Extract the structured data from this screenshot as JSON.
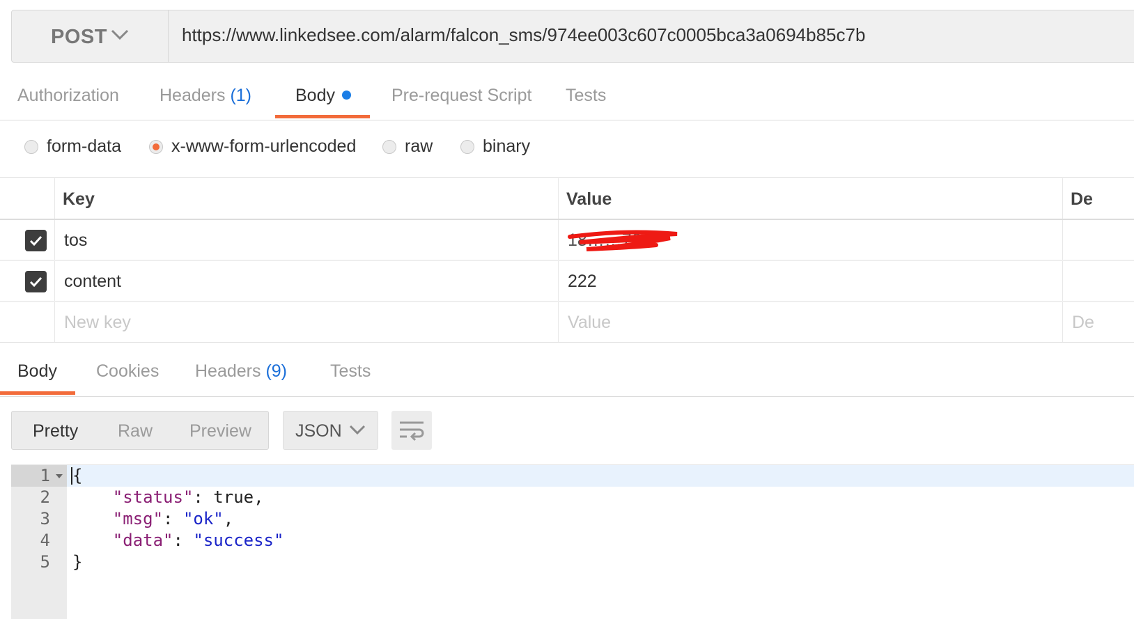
{
  "request": {
    "method": "POST",
    "url": "https://www.linkedsee.com/alarm/falcon_sms/974ee003c607c0005bca3a0694b85c7b"
  },
  "request_tabs": [
    {
      "label": "Authorization"
    },
    {
      "label": "Headers",
      "count": "(1)"
    },
    {
      "label": "Body",
      "active": true
    },
    {
      "label": "Pre-request Script"
    },
    {
      "label": "Tests"
    }
  ],
  "body_modes": [
    {
      "label": "form-data",
      "selected": false
    },
    {
      "label": "x-www-form-urlencoded",
      "selected": true
    },
    {
      "label": "raw",
      "selected": false
    },
    {
      "label": "binary",
      "selected": false
    }
  ],
  "kv_table": {
    "headers": {
      "key": "Key",
      "value": "Value",
      "description": "De"
    },
    "rows": [
      {
        "checked": true,
        "key": "tos",
        "value": "18……76",
        "value_redacted": true
      },
      {
        "checked": true,
        "key": "content",
        "value": "222"
      }
    ],
    "placeholder": {
      "key": "New key",
      "value": "Value",
      "description": "De"
    }
  },
  "response_tabs": [
    {
      "label": "Body",
      "active": true
    },
    {
      "label": "Cookies"
    },
    {
      "label": "Headers",
      "count": "(9)"
    },
    {
      "label": "Tests"
    }
  ],
  "view_modes": [
    {
      "label": "Pretty",
      "active": true
    },
    {
      "label": "Raw"
    },
    {
      "label": "Preview"
    }
  ],
  "format": {
    "label": "JSON"
  },
  "code": {
    "line_numbers": [
      "1",
      "2",
      "3",
      "4",
      "5"
    ],
    "open_brace": "{",
    "close_brace": "}",
    "status_key": "\"status\"",
    "status_val": "true",
    "msg_key": "\"msg\"",
    "msg_val": "\"ok\"",
    "data_key": "\"data\"",
    "data_val": "\"success\"",
    "colon": ": ",
    "comma": ","
  },
  "colors": {
    "accent": "#f26b3a",
    "link_blue": "#1b6fd9",
    "json_key": "#8a1f74",
    "json_string": "#1a24c8"
  }
}
